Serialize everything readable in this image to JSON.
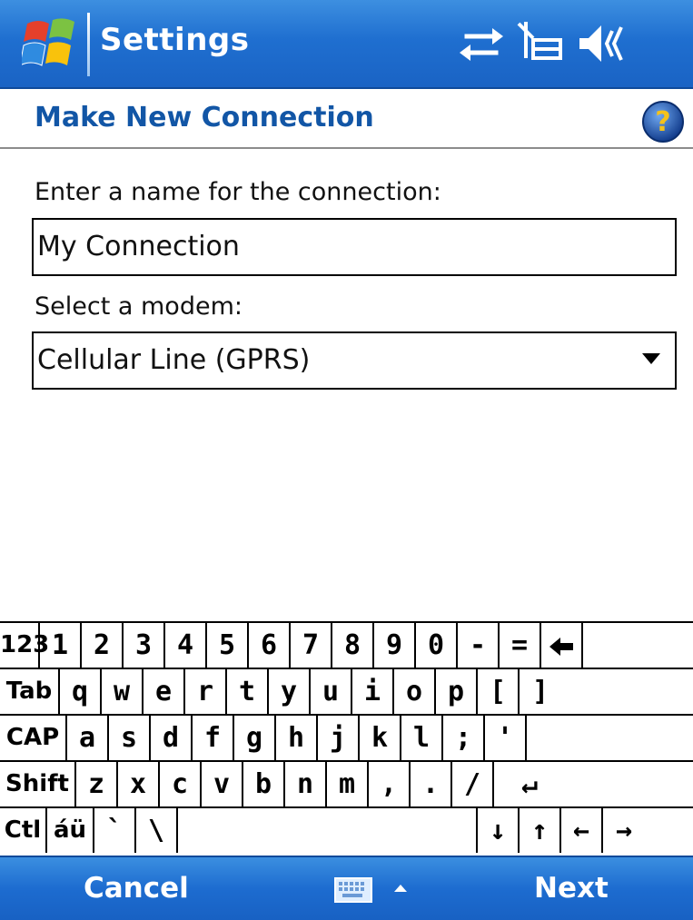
{
  "titlebar": {
    "title": "Settings",
    "icons": [
      "windows-start-icon",
      "sync-arrows-icon",
      "antenna-off-icon",
      "speaker-icon"
    ]
  },
  "header": {
    "title": "Make New Connection",
    "help_icon": "help-icon"
  },
  "form": {
    "name_label": "Enter a name for the connection:",
    "name_value": "My Connection",
    "modem_label": "Select a modem:",
    "modem_value": "Cellular Line (GPRS)"
  },
  "keyboard": {
    "rows": [
      [
        "123",
        "1",
        "2",
        "3",
        "4",
        "5",
        "6",
        "7",
        "8",
        "9",
        "0",
        "-",
        "=",
        "◆"
      ],
      [
        "Tab",
        "q",
        "w",
        "e",
        "r",
        "t",
        "y",
        "u",
        "i",
        "o",
        "p",
        "[",
        "]"
      ],
      [
        "CAP",
        "a",
        "s",
        "d",
        "f",
        "g",
        "h",
        "j",
        "k",
        "l",
        ";",
        "'"
      ],
      [
        "Shift",
        "z",
        "x",
        "c",
        "v",
        "b",
        "n",
        "m",
        ",",
        ".",
        "/",
        "↵"
      ],
      [
        "Ctl",
        "áü",
        "`",
        "\\",
        " ",
        "↓",
        "↑",
        "←",
        "→"
      ]
    ]
  },
  "menubar": {
    "left": "Cancel",
    "right": "Next",
    "center_icon": "keyboard-icon"
  },
  "colors": {
    "bar_blue": "#1f6fd0",
    "header_text": "#1256a6"
  }
}
